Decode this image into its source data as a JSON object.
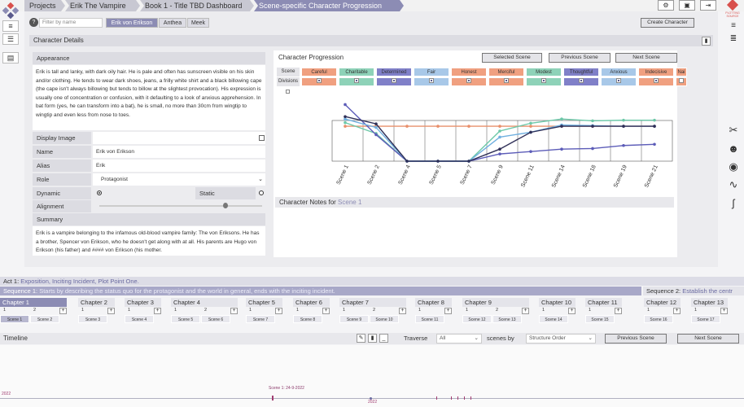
{
  "breadcrumbs": [
    "Projects",
    "Erik The Vampire",
    "Book 1 - Title TBD Dashboard",
    "Scene-specific Character Progression"
  ],
  "top_icons": [
    "gear-icon",
    "user-icon",
    "logout-icon"
  ],
  "brand_text": "PLOTTING SOURCE",
  "left_sidebar": [
    "logo-icon",
    "menu-icon",
    "list-icon",
    "archive-icon"
  ],
  "right_sidebar": [
    "menu-icon",
    "notes-icon",
    "tools-icon",
    "face-icon",
    "compass-icon",
    "chart-icon",
    "signature-icon"
  ],
  "filter": {
    "help": "?",
    "placeholder": "Filter by name"
  },
  "character_tabs": [
    "Erik von Erikson",
    "Anthea",
    "Meek"
  ],
  "create_character": "Create Character",
  "character_details": {
    "header": "Character Details",
    "appearance_label": "Appearance",
    "appearance_text": "Erik is tall and lanky, with dark oily hair. He is pale and often has sunscreen visible on his skin and/or clothing. He tends to wear dark shoes, jeans, a frilly white shirt and a black billowing cape (the cape isn't always billowing but tends to billow at the slightest provocation). His expression is usually one of concentration or confusion, with it defaulting to a look of anxious apprehension. In bat form (yes, he can transform into a bat), he is small, no more than 30cm from wingtip to wingtip and even less from nose to toes.",
    "display_image_label": "Display Image",
    "name_label": "Name",
    "name_value": "Erik von Erikson",
    "alias_label": "Alias",
    "alias_value": "Erik",
    "role_label": "Role",
    "role_value": "Protagonist",
    "dynamic_label": "Dynamic",
    "static_label": "Static",
    "alignment_label": "Alignment",
    "summary_label": "Summary",
    "summary_text": "Erik is a vampire belonging to the infamous old-blood vampire family: The von Eriksons. He has a brother, Spencer von Erikson, who he doesn't get along with at all. His parents are Hugo von Erikson (his father) and #### von Erikson (his mother."
  },
  "progression": {
    "header": "Character Progression",
    "selected_scene": "Selected Scene",
    "previous_scene": "Previous Scene",
    "next_scene": "Next Scene",
    "row_labels": [
      "Scene",
      "Divisions"
    ],
    "traits": [
      {
        "name": "Careful",
        "color": "#f0a080",
        "checked": true
      },
      {
        "name": "Charitable",
        "color": "#8ed2b8",
        "checked": true
      },
      {
        "name": "Determined",
        "color": "#8080c8",
        "checked": true
      },
      {
        "name": "Fair",
        "color": "#a8c8e8",
        "checked": true
      },
      {
        "name": "Honest",
        "color": "#f0a080",
        "checked": true
      },
      {
        "name": "Merciful",
        "color": "#f0a080",
        "checked": true
      },
      {
        "name": "Modest",
        "color": "#8ed2b8",
        "checked": true
      },
      {
        "name": "Thoughtful",
        "color": "#8080c8",
        "checked": true
      },
      {
        "name": "Anxious",
        "color": "#a8c8e8",
        "checked": true
      },
      {
        "name": "Indecisive",
        "color": "#f0a080",
        "checked": true
      },
      {
        "name": "Nai",
        "color": "#f0a080",
        "checked": false
      }
    ],
    "notes_label": "Character Notes for",
    "notes_scene": "Scene 1"
  },
  "chart_data": {
    "type": "line",
    "categories": [
      "Scene 1",
      "Scene 2",
      "Scene 4",
      "Scene 5",
      "Scene 7",
      "Scene 9",
      "Scene 11",
      "Scene 14",
      "Scene 18",
      "Scene 19",
      "Scene 21"
    ],
    "ylim": [
      0,
      10
    ],
    "series": [
      {
        "color": "#e8906c",
        "values": [
          5.8,
          5.8,
          5.8,
          5.8,
          5.8,
          5.8,
          5.8,
          5.8,
          5.8,
          5.8,
          5.8
        ]
      },
      {
        "color": "#6cc8a8",
        "values": [
          6.4,
          4.6,
          0,
          0,
          0,
          5.0,
          6.3,
          7.0,
          6.7,
          6.8,
          6.8
        ]
      },
      {
        "color": "#5c5cb8",
        "values": [
          9.4,
          4.4,
          0,
          0,
          0,
          1.2,
          1.6,
          2.0,
          2.1,
          2.6,
          2.8
        ]
      },
      {
        "color": "#70b0e0",
        "values": [
          7.0,
          5.6,
          0,
          0,
          0,
          4.0,
          4.8,
          6.0,
          5.9,
          5.8,
          5.8
        ]
      },
      {
        "color": "#303058",
        "values": [
          7.4,
          6.2,
          0,
          0,
          0,
          2.0,
          4.8,
          5.8,
          5.8,
          5.8,
          5.8
        ]
      }
    ]
  },
  "act": {
    "label": "Act 1:",
    "text": "Exposition, Inciting Incident, Plot Point One."
  },
  "sequences": [
    {
      "label": "Sequence 1:",
      "text": "Starts by describing the status quo for the protagonist and the world in general, ends with the inciting incident."
    },
    {
      "label": "Sequence 2:",
      "text": "Establish the centr"
    }
  ],
  "chapters": [
    {
      "label": "Chapter 1",
      "nums": [
        "1",
        "2"
      ],
      "scenes": [
        "Scene 1",
        "Scene 2"
      ]
    },
    {
      "label": "Chapter 2",
      "nums": [
        "1"
      ],
      "scenes": [
        "Scene 3"
      ]
    },
    {
      "label": "Chapter 3",
      "nums": [
        "1"
      ],
      "scenes": [
        "Scene 4"
      ]
    },
    {
      "label": "Chapter 4",
      "nums": [
        "1",
        "2"
      ],
      "scenes": [
        "Scene 5",
        "Scene 6"
      ]
    },
    {
      "label": "Chapter 5",
      "nums": [
        "1"
      ],
      "scenes": [
        "Scene 7"
      ]
    },
    {
      "label": "Chapter 6",
      "nums": [
        "1"
      ],
      "scenes": [
        "Scene 8"
      ]
    },
    {
      "label": "Chapter 7",
      "nums": [
        "1",
        "2"
      ],
      "scenes": [
        "Scene 9",
        "Scene 10"
      ]
    },
    {
      "label": "Chapter 8",
      "nums": [
        "1"
      ],
      "scenes": [
        "Scene 11"
      ]
    },
    {
      "label": "Chapter 9",
      "nums": [
        "1",
        "2"
      ],
      "scenes": [
        "Scene 12",
        "Scene 13"
      ]
    },
    {
      "label": "Chapter 10",
      "nums": [
        "1"
      ],
      "scenes": [
        "Scene 14"
      ]
    },
    {
      "label": "Chapter 11",
      "nums": [
        "1"
      ],
      "scenes": [
        "Scene 15"
      ]
    },
    {
      "label": "Chapter 12",
      "nums": [
        "1"
      ],
      "scenes": [
        "Scene 16"
      ]
    },
    {
      "label": "Chapter 13",
      "nums": [
        "1"
      ],
      "scenes": [
        "Scene 17"
      ]
    }
  ],
  "timeline": {
    "label": "Timeline",
    "traverse_label": "Traverse",
    "traverse_value": "All",
    "scenes_by_label": "scenes by",
    "scenes_by_value": "Structure Order",
    "previous_scene": "Previous Scene",
    "next_scene": "Next Scene",
    "marker_label": "Scene 1: 24-9-2022",
    "year_left": "2022",
    "year_mid": "2022"
  }
}
